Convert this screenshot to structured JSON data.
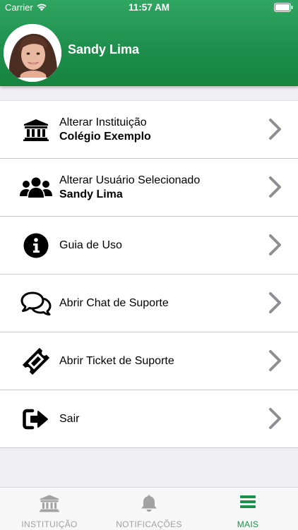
{
  "status_bar": {
    "carrier": "Carrier",
    "time": "11:57 AM"
  },
  "profile": {
    "name": "Sandy Lima"
  },
  "menu": {
    "items": [
      {
        "label": "Alterar Instituição",
        "sub": "Colégio Exemplo",
        "icon": "institution-icon"
      },
      {
        "label": "Alterar Usuário Selecionado",
        "sub": "Sandy Lima",
        "icon": "users-icon"
      },
      {
        "label": "Guia de Uso",
        "icon": "info-icon"
      },
      {
        "label": "Abrir Chat de Suporte",
        "icon": "chat-icon"
      },
      {
        "label": "Abrir Ticket de Suporte",
        "icon": "ticket-icon"
      },
      {
        "label": "Sair",
        "icon": "sign-out-icon"
      }
    ]
  },
  "tabbar": {
    "tabs": [
      {
        "label": "INSTITUIÇÃO",
        "icon": "institution-icon"
      },
      {
        "label": "NOTIFICAÇÕES",
        "icon": "bell-icon"
      },
      {
        "label": "MAIS",
        "icon": "menu-icon",
        "active": true
      }
    ]
  },
  "colors": {
    "header_green": "#1f8f4d",
    "active_tab": "#1f8f4d",
    "inactive_tab": "#a2a2a2",
    "chevron": "#8e8e93"
  }
}
